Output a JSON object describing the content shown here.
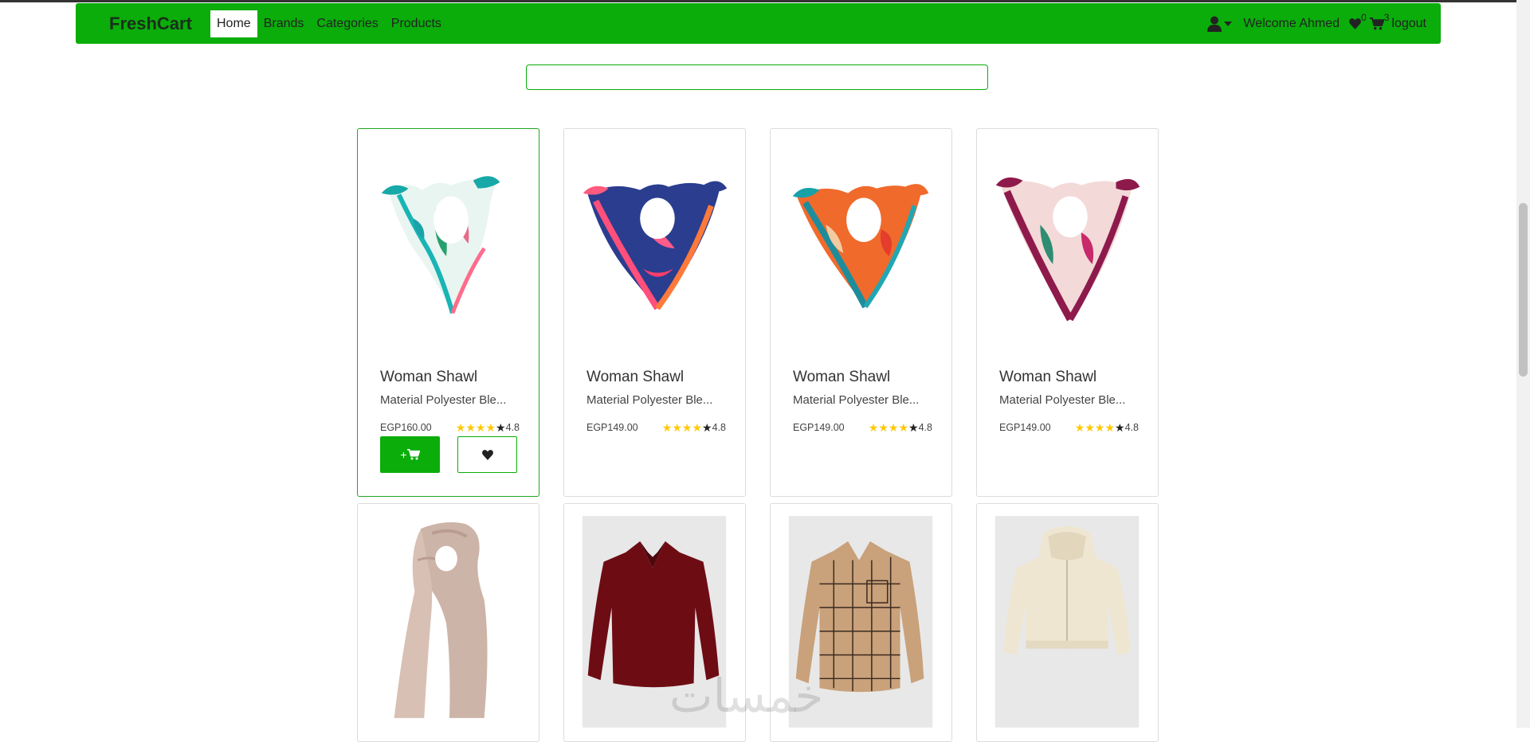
{
  "nav": {
    "brand": "FreshCart",
    "links": [
      "Home",
      "Brands",
      "Categories",
      "Products"
    ],
    "welcome": "Welcome Ahmed",
    "wishlist_count": "0",
    "cart_count": "3",
    "logout": "logout"
  },
  "search": {
    "value": "",
    "placeholder": ""
  },
  "products": [
    {
      "title": "Woman Shawl",
      "desc": "Material Polyester Ble...",
      "price": "EGP160.00",
      "rating": "4.8",
      "image": "scarf-teal-floral"
    },
    {
      "title": "Woman Shawl",
      "desc": "Material Polyester Ble...",
      "price": "EGP149.00",
      "rating": "4.8",
      "image": "scarf-navy-pink"
    },
    {
      "title": "Woman Shawl",
      "desc": "Material Polyester Ble...",
      "price": "EGP149.00",
      "rating": "4.8",
      "image": "scarf-orange-teal"
    },
    {
      "title": "Woman Shawl",
      "desc": "Material Polyester Ble...",
      "price": "EGP149.00",
      "rating": "4.8",
      "image": "scarf-magenta-floral"
    }
  ],
  "products_row2": [
    {
      "image": "beige-scarf"
    },
    {
      "image": "burgundy-blouse"
    },
    {
      "image": "plaid-shirt"
    },
    {
      "image": "cream-hoodie"
    }
  ],
  "watermark": "خمسات",
  "colors": {
    "brand_green": "#0aad0a",
    "star_gold": "#ffc908"
  }
}
